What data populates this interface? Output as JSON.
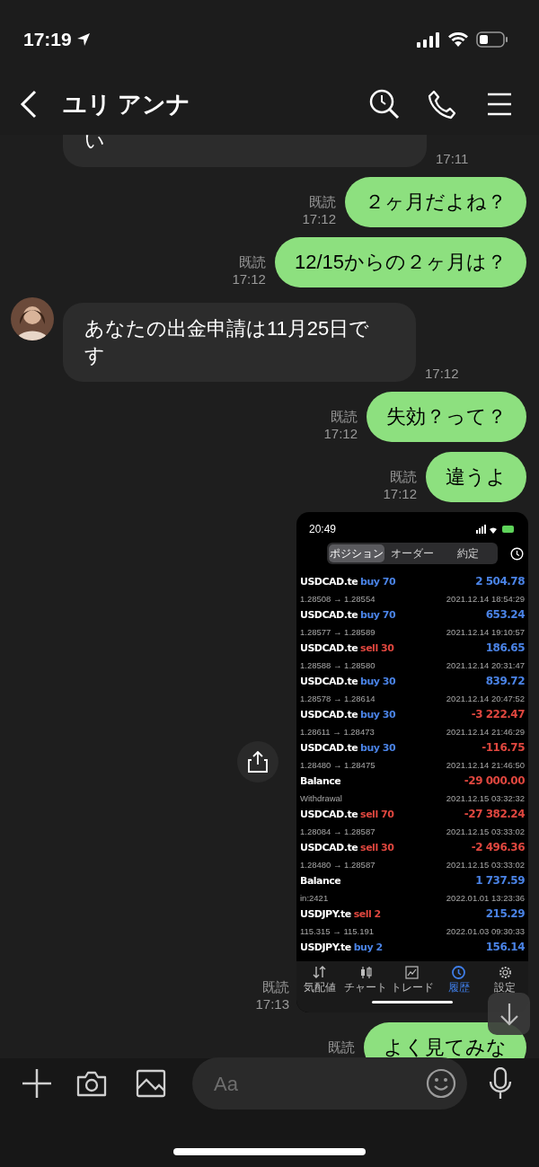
{
  "status_bar": {
    "time": "17:19"
  },
  "header": {
    "title": "ユリ アンナ"
  },
  "messages": [
    {
      "kind": "received",
      "text": "い",
      "time": "17:11"
    },
    {
      "kind": "sent",
      "read": "既読",
      "time": "17:12",
      "text": "２ヶ月だよね？"
    },
    {
      "kind": "sent",
      "read": "既読",
      "time": "17:12",
      "text": "12/15からの２ヶ月は？"
    },
    {
      "kind": "received",
      "avatar": true,
      "text": "あなたの出金申請は11月25日です",
      "time": "17:12"
    },
    {
      "kind": "sent",
      "read": "既読",
      "time": "17:12",
      "text": "失効？って？"
    },
    {
      "kind": "sent",
      "read": "既読",
      "time": "17:12",
      "text": "違うよ"
    },
    {
      "kind": "image",
      "read": "既読",
      "time": "17:13",
      "shot": {
        "time": "20:49",
        "tabs": [
          {
            "label": "ポジション",
            "selected": true
          },
          {
            "label": "オーダー",
            "selected": false
          },
          {
            "label": "約定",
            "selected": false
          }
        ],
        "rows": [
          {
            "kind": "buy",
            "symbol": "USDCAD.te",
            "side": "buy 70",
            "amount": "2 504.78",
            "profit": true,
            "detail": "1.28508 → 1.28554",
            "date": "2021.12.14 18:54:29"
          },
          {
            "kind": "buy",
            "symbol": "USDCAD.te",
            "side": "buy 70",
            "amount": "653.24",
            "profit": true,
            "detail": "1.28577 → 1.28589",
            "date": "2021.12.14 19:10:57"
          },
          {
            "kind": "sell",
            "symbol": "USDCAD.te",
            "side": "sell 30",
            "amount": "186.65",
            "profit": true,
            "detail": "1.28588 → 1.28580",
            "date": "2021.12.14 20:31:47"
          },
          {
            "kind": "buy",
            "symbol": "USDCAD.te",
            "side": "buy 30",
            "amount": "839.72",
            "profit": true,
            "detail": "1.28578 → 1.28614",
            "date": "2021.12.14 20:47:52"
          },
          {
            "kind": "buy",
            "symbol": "USDCAD.te",
            "side": "buy 30",
            "amount": "-3 222.47",
            "profit": false,
            "detail": "1.28611 → 1.28473",
            "date": "2021.12.14 21:46:29"
          },
          {
            "kind": "buy",
            "symbol": "USDCAD.te",
            "side": "buy 30",
            "amount": "-116.75",
            "profit": false,
            "detail": "1.28480 → 1.28475",
            "date": "2021.12.14 21:46:50"
          },
          {
            "symbol": "Balance",
            "amount": "-29 000.00",
            "profit": false,
            "detail": "Withdrawal",
            "date": "2021.12.15 03:32:32"
          },
          {
            "kind": "sell",
            "symbol": "USDCAD.te",
            "side": "sell 70",
            "amount": "-27 382.24",
            "profit": false,
            "detail": "1.28084 → 1.28587",
            "date": "2021.12.15 03:33:02"
          },
          {
            "kind": "sell",
            "symbol": "USDCAD.te",
            "side": "sell 30",
            "amount": "-2 496.36",
            "profit": false,
            "detail": "1.28480 → 1.28587",
            "date": "2021.12.15 03:33:02"
          },
          {
            "symbol": "Balance",
            "amount": "1 737.59",
            "profit": true,
            "detail": "in:2421",
            "date": "2022.01.01 13:23:36"
          },
          {
            "kind": "sell",
            "symbol": "USDJPY.te",
            "side": "sell 2",
            "amount": "215.29",
            "profit": true,
            "detail": "115.315 → 115.191",
            "date": "2022.01.03 09:30:33"
          },
          {
            "kind": "buy",
            "symbol": "USDJPY.te",
            "side": "buy 2",
            "amount": "156.14",
            "profit": true
          }
        ],
        "nav": [
          {
            "kind": "quotes",
            "label": "気配値",
            "selected": false
          },
          {
            "kind": "chart",
            "label": "チャート",
            "selected": false
          },
          {
            "kind": "trade",
            "label": "トレード",
            "selected": false
          },
          {
            "kind": "history",
            "label": "履歴",
            "selected": true
          },
          {
            "kind": "settings",
            "label": "設定",
            "selected": false
          }
        ]
      }
    },
    {
      "kind": "sent",
      "read": "既読",
      "text": "よく見てみな"
    }
  ],
  "composer": {
    "placeholder": "Aa"
  }
}
